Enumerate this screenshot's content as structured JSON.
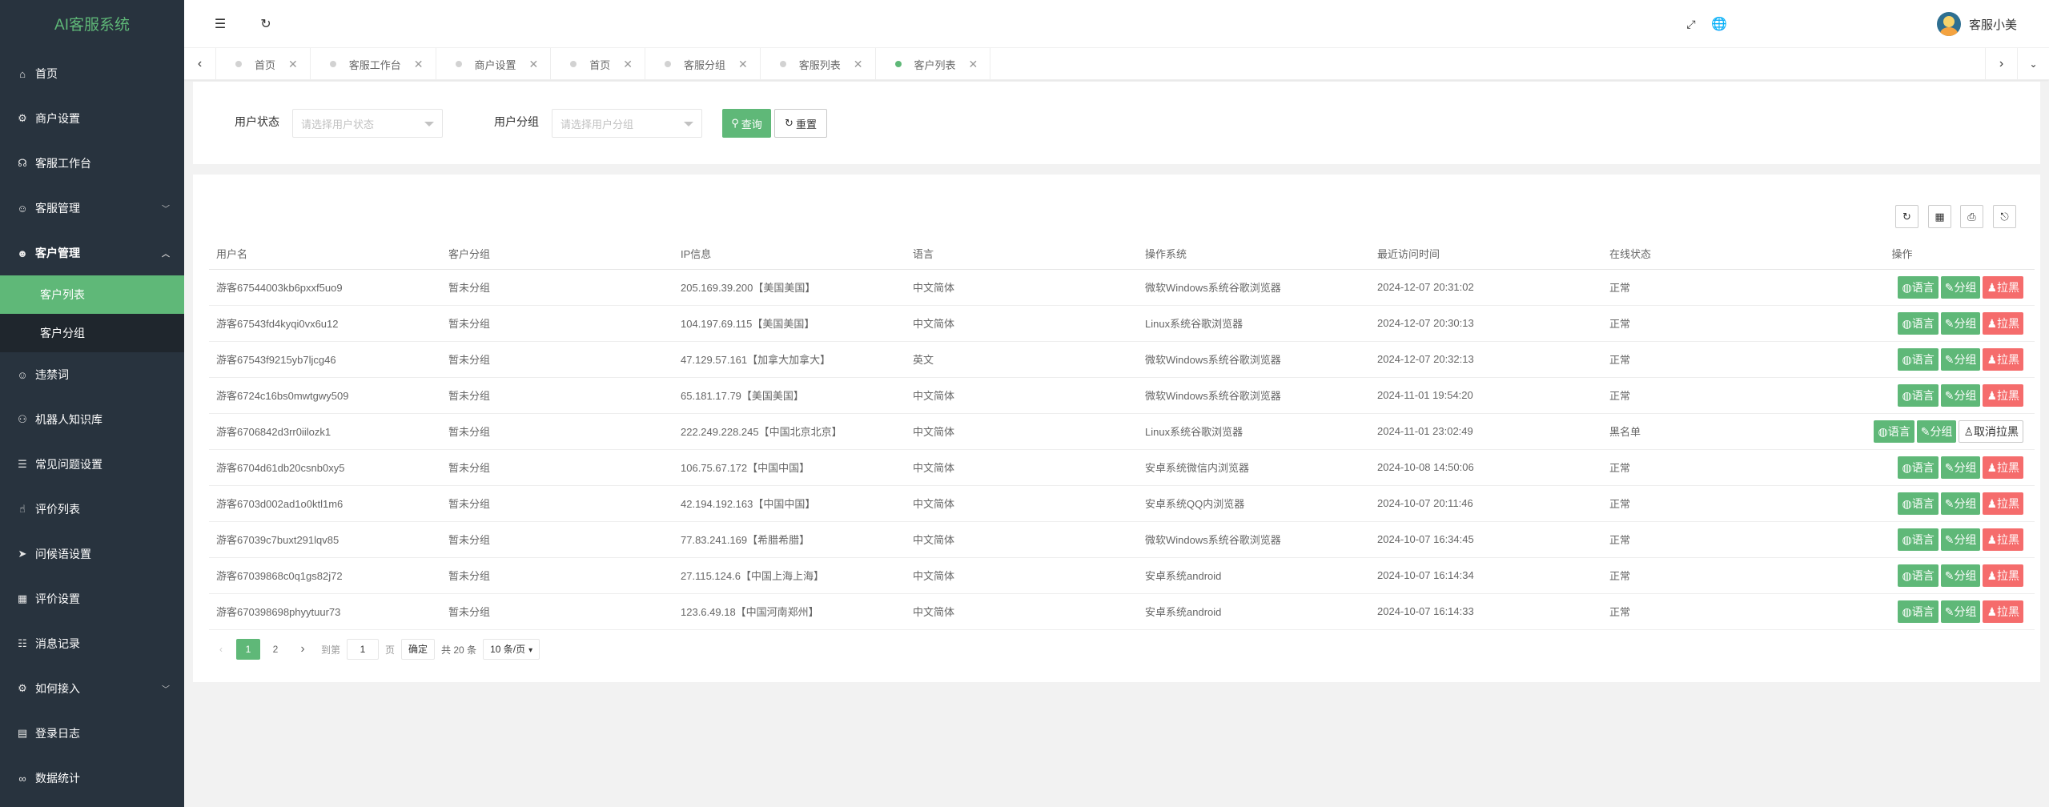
{
  "app": {
    "title": "AI客服系统"
  },
  "sidebar": {
    "items": [
      {
        "label": "首页",
        "icon": "home-icon"
      },
      {
        "label": "商户设置",
        "icon": "gear-icon"
      },
      {
        "label": "客服工作台",
        "icon": "headset-icon"
      },
      {
        "label": "客服管理",
        "icon": "user-icon",
        "expandable": true
      },
      {
        "label": "客户管理",
        "icon": "users-icon",
        "expandable": true,
        "open": true,
        "children": [
          {
            "label": "客户列表",
            "active": true
          },
          {
            "label": "客户分组"
          }
        ]
      },
      {
        "label": "违禁词",
        "icon": "smile-icon"
      },
      {
        "label": "机器人知识库",
        "icon": "robot-icon"
      },
      {
        "label": "常见问题设置",
        "icon": "faq-icon"
      },
      {
        "label": "评价列表",
        "icon": "thumbs-up-icon"
      },
      {
        "label": "问候语设置",
        "icon": "send-icon"
      },
      {
        "label": "评价设置",
        "icon": "calendar-icon"
      },
      {
        "label": "消息记录",
        "icon": "message-icon"
      },
      {
        "label": "如何接入",
        "icon": "plug-icon",
        "expandable": true
      },
      {
        "label": "登录日志",
        "icon": "log-icon"
      },
      {
        "label": "数据统计",
        "icon": "chart-icon"
      }
    ]
  },
  "header": {
    "username": "客服小美"
  },
  "tabs": [
    {
      "label": "首页"
    },
    {
      "label": "客服工作台"
    },
    {
      "label": "商户设置"
    },
    {
      "label": "首页"
    },
    {
      "label": "客服分组"
    },
    {
      "label": "客服列表"
    },
    {
      "label": "客户列表",
      "active": true
    }
  ],
  "filters": {
    "status_label": "用户状态",
    "status_placeholder": "请选择用户状态",
    "group_label": "用户分组",
    "group_placeholder": "请选择用户分组",
    "query_button": "查询",
    "reset_button": "重置"
  },
  "table": {
    "columns": [
      "用户名",
      "客户分组",
      "IP信息",
      "语言",
      "操作系统",
      "最近访问时间",
      "在线状态",
      "操作"
    ],
    "rows": [
      {
        "username": "游客67544003kb6pxxf5uo9",
        "group": "暂未分组",
        "ip": "205.169.39.200【美国美国】",
        "lang": "中文简体",
        "os": "微软Windows系统谷歌浏览器",
        "time": "2024-12-07 20:31:02",
        "status": "正常",
        "blocked": false
      },
      {
        "username": "游客67543fd4kyqi0vx6u12",
        "group": "暂未分组",
        "ip": "104.197.69.115【美国美国】",
        "lang": "中文简体",
        "os": "Linux系统谷歌浏览器",
        "time": "2024-12-07 20:30:13",
        "status": "正常",
        "blocked": false
      },
      {
        "username": "游客67543f9215yb7ljcg46",
        "group": "暂未分组",
        "ip": "47.129.57.161【加拿大加拿大】",
        "lang": "英文",
        "os": "微软Windows系统谷歌浏览器",
        "time": "2024-12-07 20:32:13",
        "status": "正常",
        "blocked": false
      },
      {
        "username": "游客6724c16bs0mwtgwy509",
        "group": "暂未分组",
        "ip": "65.181.17.79【美国美国】",
        "lang": "中文简体",
        "os": "微软Windows系统谷歌浏览器",
        "time": "2024-11-01 19:54:20",
        "status": "正常",
        "blocked": false
      },
      {
        "username": "游客6706842d3rr0iilozk1",
        "group": "暂未分组",
        "ip": "222.249.228.245【中国北京北京】",
        "lang": "中文简体",
        "os": "Linux系统谷歌浏览器",
        "time": "2024-11-01 23:02:49",
        "status": "黑名单",
        "blocked": true
      },
      {
        "username": "游客6704d61db20csnb0xy5",
        "group": "暂未分组",
        "ip": "106.75.67.172【中国中国】",
        "lang": "中文简体",
        "os": "安卓系统微信内浏览器",
        "time": "2024-10-08 14:50:06",
        "status": "正常",
        "blocked": false
      },
      {
        "username": "游客6703d002ad1o0ktl1m6",
        "group": "暂未分组",
        "ip": "42.194.192.163【中国中国】",
        "lang": "中文简体",
        "os": "安卓系统QQ内浏览器",
        "time": "2024-10-07 20:11:46",
        "status": "正常",
        "blocked": false
      },
      {
        "username": "游客67039c7buxt291lqv85",
        "group": "暂未分组",
        "ip": "77.83.241.169【希腊希腊】",
        "lang": "中文简体",
        "os": "微软Windows系统谷歌浏览器",
        "time": "2024-10-07 16:34:45",
        "status": "正常",
        "blocked": false
      },
      {
        "username": "游客67039868c0q1gs82j72",
        "group": "暂未分组",
        "ip": "27.115.124.6【中国上海上海】",
        "lang": "中文简体",
        "os": "安卓系统android",
        "time": "2024-10-07 16:14:34",
        "status": "正常",
        "blocked": false
      },
      {
        "username": "游客670398698phyytuur73",
        "group": "暂未分组",
        "ip": "123.6.49.18【中国河南郑州】",
        "lang": "中文简体",
        "os": "安卓系统android",
        "time": "2024-10-07 16:14:33",
        "status": "正常",
        "blocked": false
      }
    ],
    "actions": {
      "lang": "语言",
      "group": "分组",
      "block": "拉黑",
      "unblock": "取消拉黑"
    }
  },
  "pagination": {
    "pages": [
      "1",
      "2"
    ],
    "current": "1",
    "goto_label": "到第",
    "goto_value": "1",
    "page_unit": "页",
    "confirm": "确定",
    "total": "共 20 条",
    "page_size": "10 条/页"
  },
  "colors": {
    "accent": "#5fb878",
    "danger": "#f56c6c",
    "sidebar": "#28333e"
  }
}
